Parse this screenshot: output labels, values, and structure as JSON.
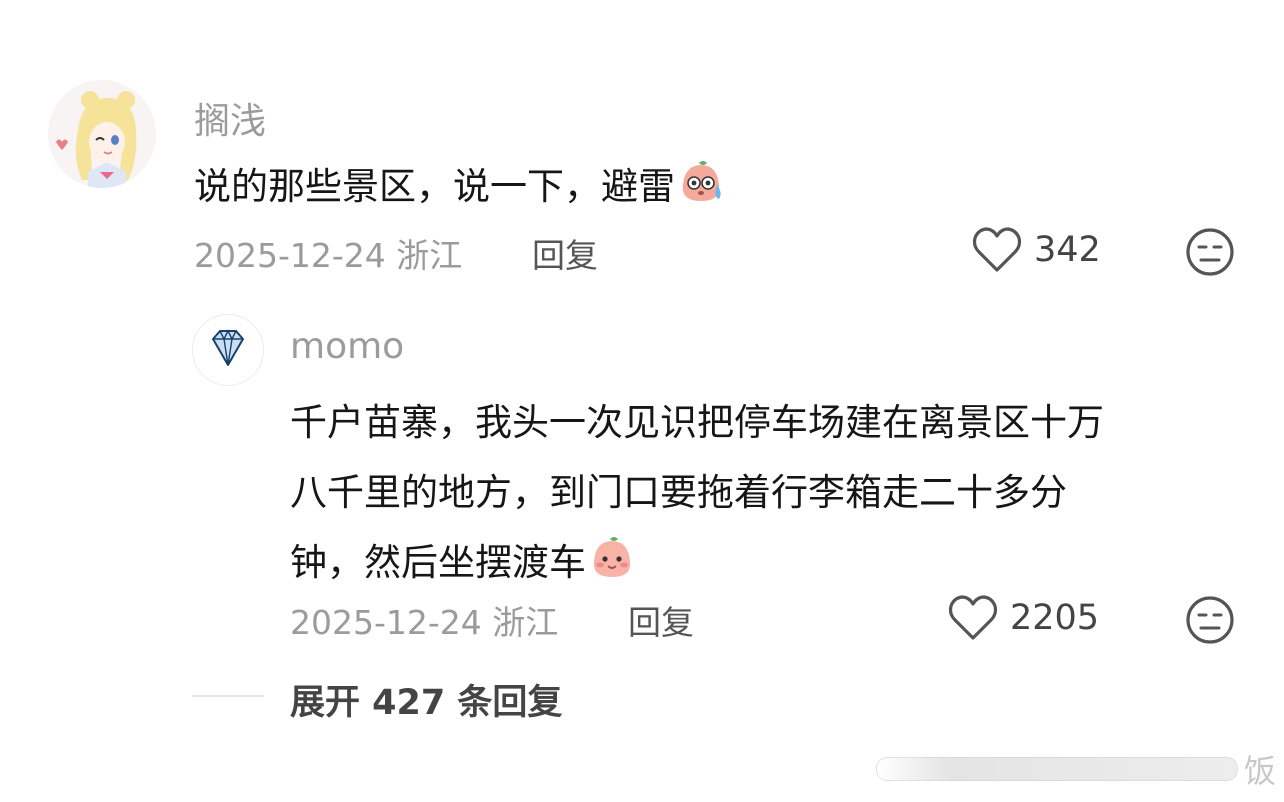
{
  "comment": {
    "username": "搁浅",
    "text": "说的那些景区，说一下，避雷",
    "text_emoji": "sweat-peach-emoji",
    "date": "2025-12-24",
    "location": "浙江",
    "reply_label": "回复",
    "like_count": "342",
    "avatar": "sailor-moon-avatar"
  },
  "reply": {
    "username": "momo",
    "lines": [
      "千户苗寨，我头一次见识把停车场建在离景区十万",
      "八千里的地方，到门口要拖着行李箱走二十多分",
      "钟，然后坐摆渡车"
    ],
    "text_emoji": "blush-peach-emoji",
    "date": "2025-12-24",
    "location": "浙江",
    "reply_label": "回复",
    "like_count": "2205",
    "avatar": "diamond-avatar"
  },
  "expand_label": "展开 427 条回复",
  "watermark_char": "饭",
  "colors": {
    "meta_gray": "#9b9b9b",
    "text_dark": "#161616",
    "peach": "#f5a99b"
  }
}
